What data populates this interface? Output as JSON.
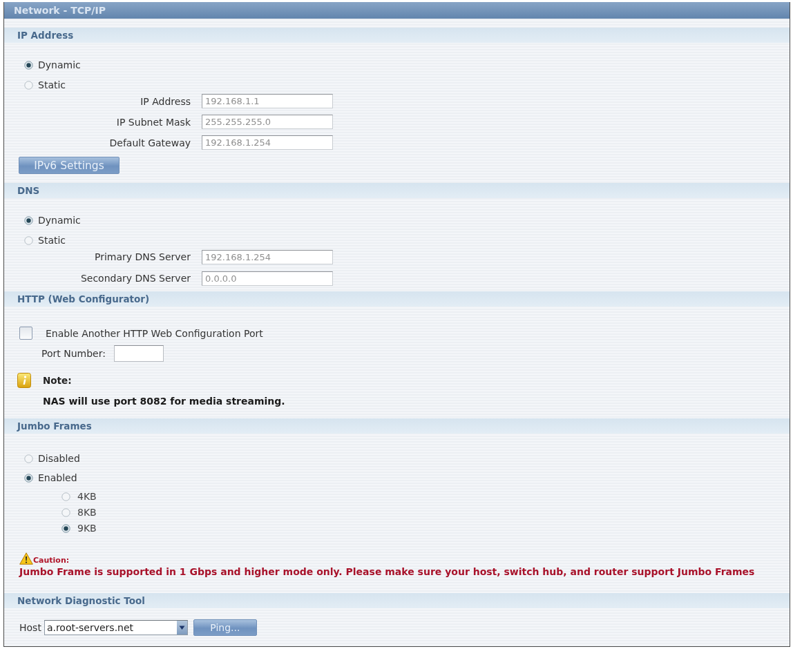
{
  "window": {
    "title": "Network - TCP/IP"
  },
  "ip_address": {
    "title": "IP Address",
    "modes": [
      {
        "label": "Dynamic",
        "selected": true
      },
      {
        "label": "Static",
        "selected": false
      }
    ],
    "fields": [
      {
        "label": "IP Address",
        "value": "192.168.1.1",
        "disabled": true
      },
      {
        "label": "IP Subnet Mask",
        "value": "255.255.255.0",
        "disabled": true
      },
      {
        "label": "Default Gateway",
        "value": "192.168.1.254",
        "disabled": true
      }
    ],
    "button": "IPv6 Settings"
  },
  "dns": {
    "title": "DNS",
    "modes": [
      {
        "label": "Dynamic",
        "selected": true
      },
      {
        "label": "Static",
        "selected": false
      }
    ],
    "fields": [
      {
        "label": "Primary DNS Server",
        "value": "192.168.1.254",
        "disabled": true
      },
      {
        "label": "Secondary DNS Server",
        "value": "0.0.0.0",
        "disabled": true
      }
    ]
  },
  "http": {
    "title": "HTTP (Web Configurator)",
    "enable": {
      "label": "Enable Another HTTP Web Configuration Port",
      "checked": false
    },
    "port": {
      "label": "Port Number:"
    },
    "note": {
      "title": "Note:",
      "text": "NAS will use port 8082 for media streaming."
    }
  },
  "jumbo_frames": {
    "title": "Jumbo Frames",
    "modes": [
      {
        "label": "Disabled",
        "selected": false
      },
      {
        "label": "Enabled",
        "selected": true
      }
    ],
    "sizes": [
      {
        "label": "4KB",
        "selected": false
      },
      {
        "label": "8KB",
        "selected": false
      },
      {
        "label": "9KB",
        "selected": true
      }
    ],
    "caution": {
      "title": "Caution:",
      "text": "Jumbo Frame is supported in 1 Gbps and higher mode only. Please make sure your host, switch hub, and router support Jumbo Frames"
    }
  },
  "diagnostic": {
    "title": "Network Diagnostic Tool",
    "host_label": "Host",
    "host": "a.root-servers.net",
    "button": "Ping..."
  }
}
